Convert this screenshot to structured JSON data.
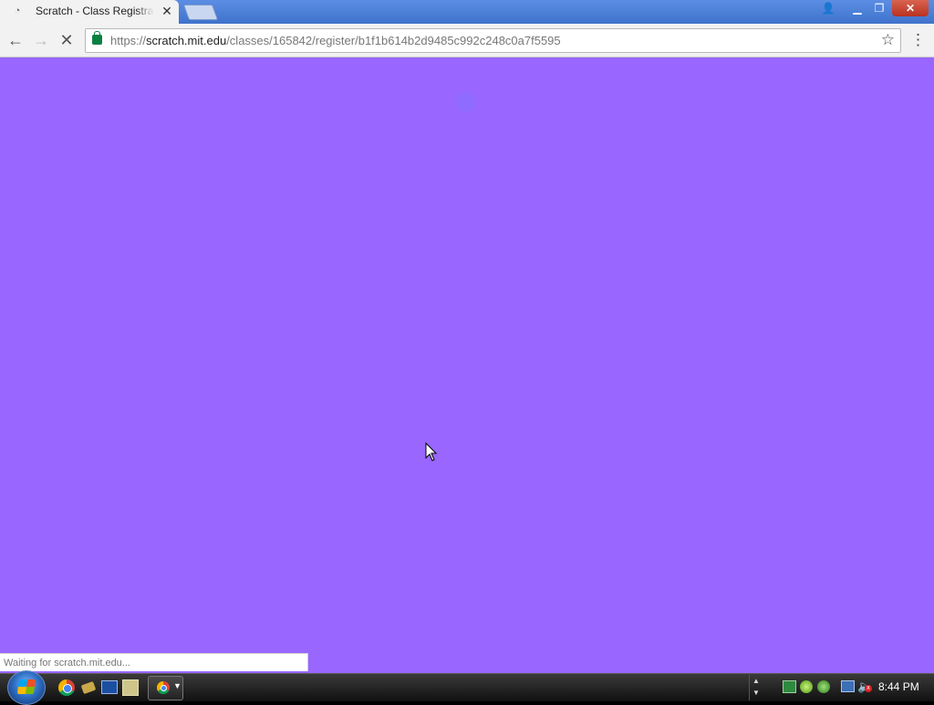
{
  "browser": {
    "tab": {
      "title": "Scratch - Class Registration",
      "favicon": "loading-icon",
      "close_label": "✕"
    },
    "newtab_label": "",
    "window_controls": {
      "profile": "👤",
      "minimize": "▁",
      "maximize": "❐",
      "close": "✕"
    },
    "toolbar": {
      "back": "←",
      "forward": "→",
      "stop": "✕",
      "url_scheme": "https://",
      "url_host": "scratch.mit.edu",
      "url_path": "/classes/165842/register/b1f1b614b2d9485c992c248c0a7f5595",
      "bookmark": "☆",
      "menu": "⋮"
    }
  },
  "page": {
    "background_color": "#9966ff",
    "status_text": "Waiting for scratch.mit.edu..."
  },
  "taskbar": {
    "clock": "8:44 PM",
    "tray_scroll_up": "▲",
    "tray_scroll_down": "▼",
    "task_arrow": "▼",
    "volume_icon": "🔈",
    "volume_muted_mark": "x"
  }
}
